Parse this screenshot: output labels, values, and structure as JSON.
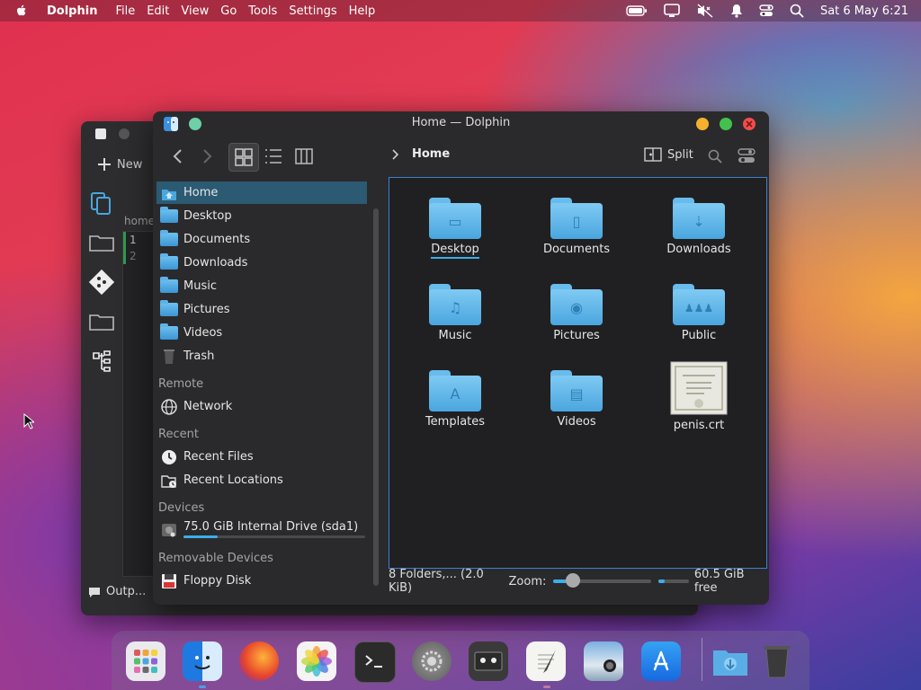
{
  "menubar": {
    "app_name": "Dolphin",
    "menus": [
      "File",
      "Edit",
      "View",
      "Go",
      "Tools",
      "Settings",
      "Help"
    ],
    "clock": "Sat 6 May  6:21",
    "icons": [
      "battery-icon",
      "display-icon",
      "mute-icon",
      "notification-icon",
      "control-center-icon",
      "search-icon"
    ]
  },
  "bg_window": {
    "new_label": "New",
    "path_label": "home",
    "line_numbers": [
      "1",
      "2"
    ],
    "output_label": "Outp..."
  },
  "window": {
    "title": "Home — Dolphin",
    "breadcrumb": "Home",
    "split_label": "Split"
  },
  "sidebar": {
    "places": [
      {
        "label": "Home",
        "icon": "home-folder-icon"
      },
      {
        "label": "Desktop",
        "icon": "desktop-folder-icon"
      },
      {
        "label": "Documents",
        "icon": "documents-folder-icon"
      },
      {
        "label": "Downloads",
        "icon": "downloads-folder-icon"
      },
      {
        "label": "Music",
        "icon": "music-folder-icon"
      },
      {
        "label": "Pictures",
        "icon": "pictures-folder-icon"
      },
      {
        "label": "Videos",
        "icon": "videos-folder-icon"
      },
      {
        "label": "Trash",
        "icon": "trash-icon"
      }
    ],
    "remote_header": "Remote",
    "remote": [
      {
        "label": "Network",
        "icon": "network-icon"
      }
    ],
    "recent_header": "Recent",
    "recent": [
      {
        "label": "Recent Files",
        "icon": "clock-icon"
      },
      {
        "label": "Recent Locations",
        "icon": "recent-locations-icon"
      }
    ],
    "devices_header": "Devices",
    "devices": [
      {
        "label": "75.0 GiB Internal Drive (sda1)",
        "icon": "drive-icon",
        "usage_fraction": 0.19
      }
    ],
    "removable_header": "Removable Devices",
    "removable": [
      {
        "label": "Floppy Disk",
        "icon": "floppy-icon"
      }
    ]
  },
  "files": [
    {
      "name": "Desktop",
      "glyph": "▭"
    },
    {
      "name": "Documents",
      "glyph": "▯"
    },
    {
      "name": "Downloads",
      "glyph": "⇣"
    },
    {
      "name": "Music",
      "glyph": "♫"
    },
    {
      "name": "Pictures",
      "glyph": "◉"
    },
    {
      "name": "Public",
      "glyph": "♟♟♟"
    },
    {
      "name": "Templates",
      "glyph": "A"
    },
    {
      "name": "Videos",
      "glyph": "▤"
    },
    {
      "name": "penis.crt",
      "glyph": ""
    }
  ],
  "status": {
    "summary": "8 Folders,... (2.0 KiB)",
    "zoom_label": "Zoom:",
    "zoom_fraction": 0.2,
    "free_space": "60.5 GiB free",
    "free_fraction": 0.2
  },
  "dock": {
    "apps": [
      "launchpad-icon",
      "finder-icon",
      "firefox-icon",
      "photos-icon",
      "terminal-icon",
      "system-settings-icon",
      "cassette-icon",
      "text-editor-icon",
      "screenshot-icon",
      "app-store-icon",
      "downloads-stack-icon",
      "trash-icon"
    ]
  },
  "colors": {
    "accent": "#3daee9",
    "selection": "#2c5a73",
    "folder": "#5aaee6"
  }
}
